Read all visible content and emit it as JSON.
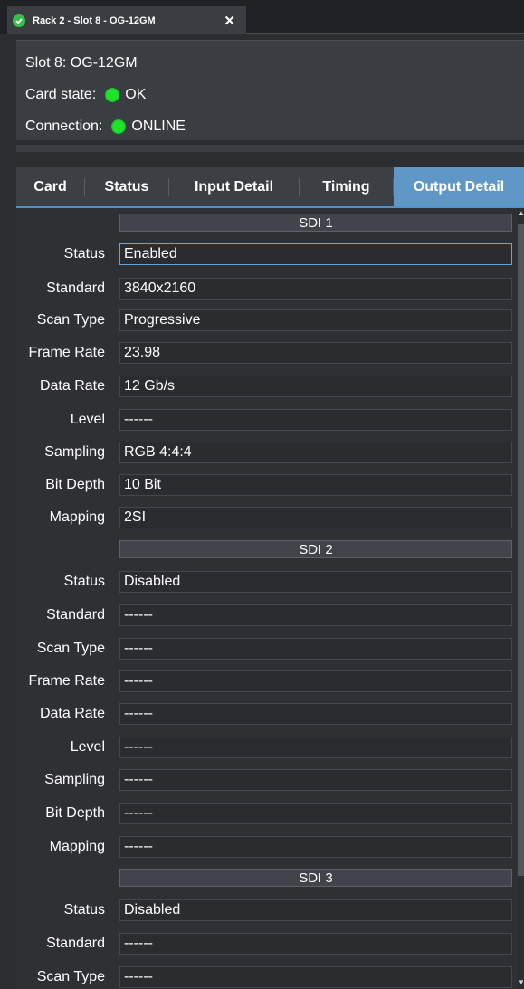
{
  "document_tab": {
    "title": "Rack 2 - Slot 8 - OG-12GM",
    "close_glyph": "✕"
  },
  "card_info": {
    "slot_line": "Slot 8: OG-12GM",
    "card_state_label": "Card state:",
    "card_state_value": "OK",
    "connection_label": "Connection:",
    "connection_value": "ONLINE",
    "status_color": "#1ee32a"
  },
  "tabs": [
    {
      "label": "Card"
    },
    {
      "label": "Status"
    },
    {
      "label": "Input Detail"
    },
    {
      "label": "Timing"
    },
    {
      "label": "Output Detail",
      "active": true
    }
  ],
  "field_labels": {
    "status": "Status",
    "standard": "Standard",
    "scan_type": "Scan Type",
    "frame_rate": "Frame Rate",
    "data_rate": "Data Rate",
    "level": "Level",
    "sampling": "Sampling",
    "bit_depth": "Bit Depth",
    "mapping": "Mapping"
  },
  "outputs": [
    {
      "name": "SDI 1",
      "status": "Enabled",
      "standard": "3840x2160",
      "scan_type": "Progressive",
      "frame_rate": "23.98",
      "data_rate": "12 Gb/s",
      "level": "------",
      "sampling": "RGB 4:4:4",
      "bit_depth": "10 Bit",
      "mapping": "2SI"
    },
    {
      "name": "SDI 2",
      "status": "Disabled",
      "standard": "------",
      "scan_type": "------",
      "frame_rate": "------",
      "data_rate": "------",
      "level": "------",
      "sampling": "------",
      "bit_depth": "------",
      "mapping": "------"
    },
    {
      "name": "SDI 3",
      "status": "Disabled",
      "standard": "------",
      "scan_type": "------"
    }
  ],
  "colors": {
    "accent": "#5f97c7",
    "ok_green": "#1ee32a"
  }
}
